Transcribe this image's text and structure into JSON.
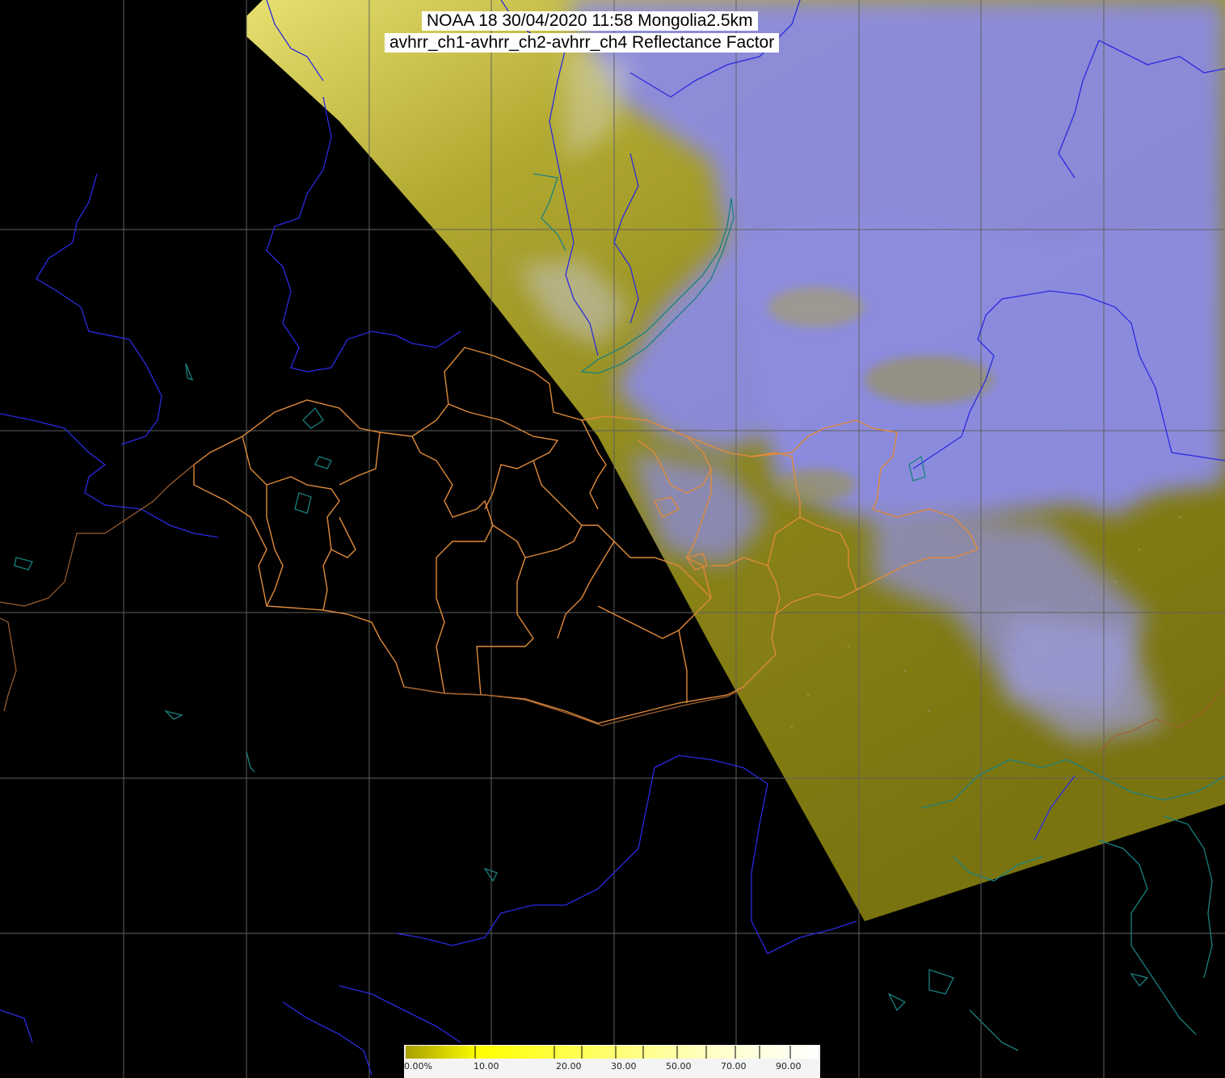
{
  "title": {
    "line1": "NOAA 18 30/04/2020 11:58 Mongolia2.5km",
    "line2": "avhrr_ch1-avhrr_ch2-avhrr_ch4 Reflectance Factor"
  },
  "colorbar": {
    "labels": [
      "0.00%",
      "10.00",
      "20.00",
      "30.00",
      "50.00",
      "70.00",
      "90.00"
    ],
    "gradient": [
      "#a8a000",
      "#ffff00",
      "#ffff60",
      "#ffffa0",
      "#ffffd8",
      "#ffffff"
    ]
  },
  "colors": {
    "swath_yellow": "#b0a820",
    "swath_olive": "#807a10",
    "cloud": "#8c8cf0",
    "rivers": "#2a2ae0",
    "lakes": "#1a8080",
    "province_borders": "#e08a3a",
    "graticule": "#606060"
  }
}
